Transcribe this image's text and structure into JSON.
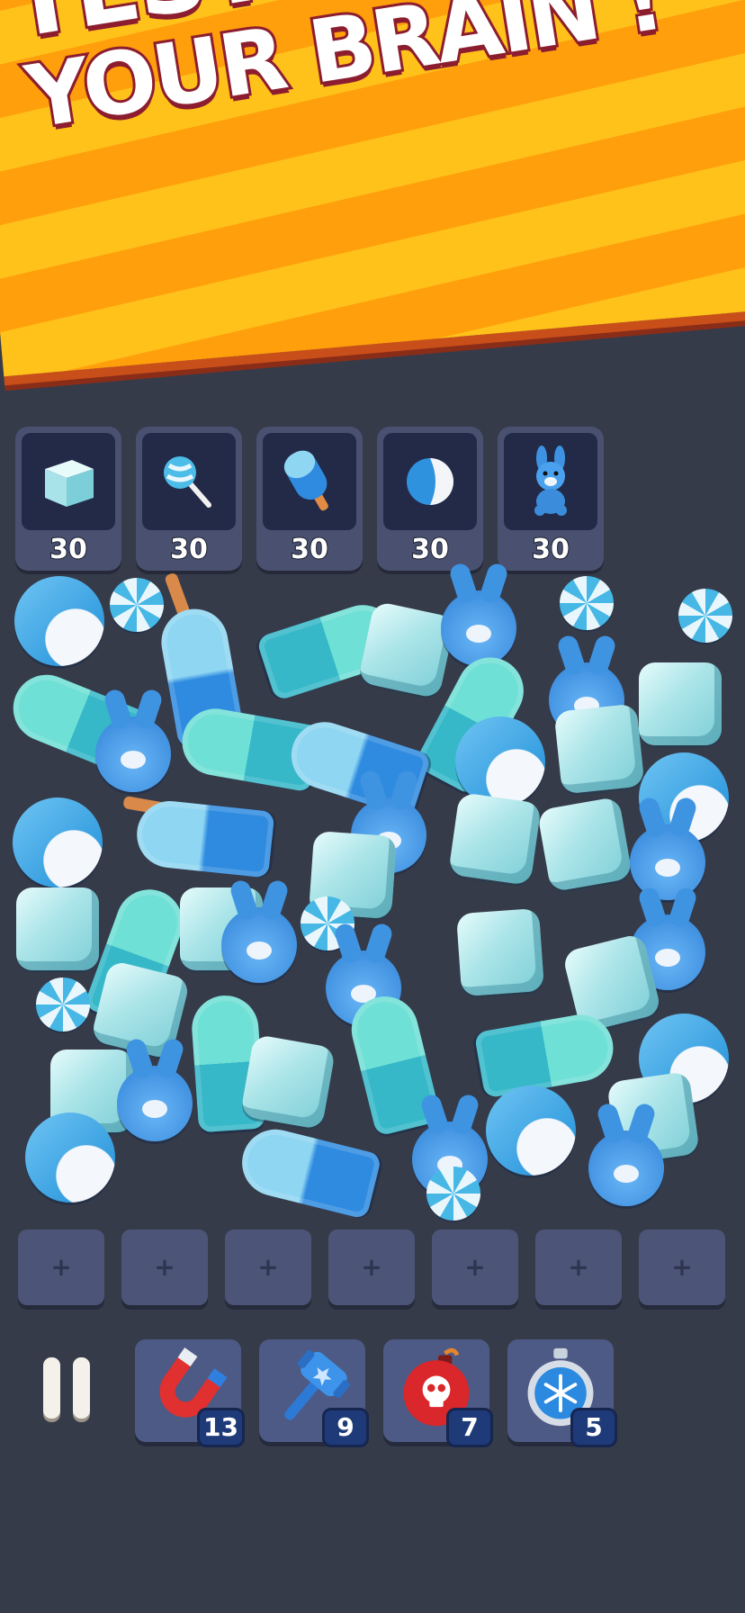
{
  "banner": {
    "line1": "TEST",
    "line2": "YOUR BRAIN !"
  },
  "goals": [
    {
      "icon": "ice-cube-icon",
      "count": "30"
    },
    {
      "icon": "lollipop-icon",
      "count": "30"
    },
    {
      "icon": "popsicle-icon",
      "count": "30"
    },
    {
      "icon": "beach-ball-icon",
      "count": "30"
    },
    {
      "icon": "bunny-toy-icon",
      "count": "30"
    }
  ],
  "slots": {
    "count": 7,
    "placeholder": "+"
  },
  "boosters": [
    {
      "icon": "magnet-icon",
      "count": "13"
    },
    {
      "icon": "hammer-icon",
      "count": "9"
    },
    {
      "icon": "skull-bomb-icon",
      "count": "7"
    },
    {
      "icon": "freeze-timer-icon",
      "count": "5"
    }
  ],
  "colors": {
    "background": "#363b4a",
    "banner_yellow": "#ffc21a",
    "banner_orange": "#ff9f0c",
    "headline_outline": "#8c1d2f",
    "tile": "#4a5170",
    "tile_well": "#222a48",
    "slot": "#4c5577",
    "booster": "#4d5a85"
  }
}
